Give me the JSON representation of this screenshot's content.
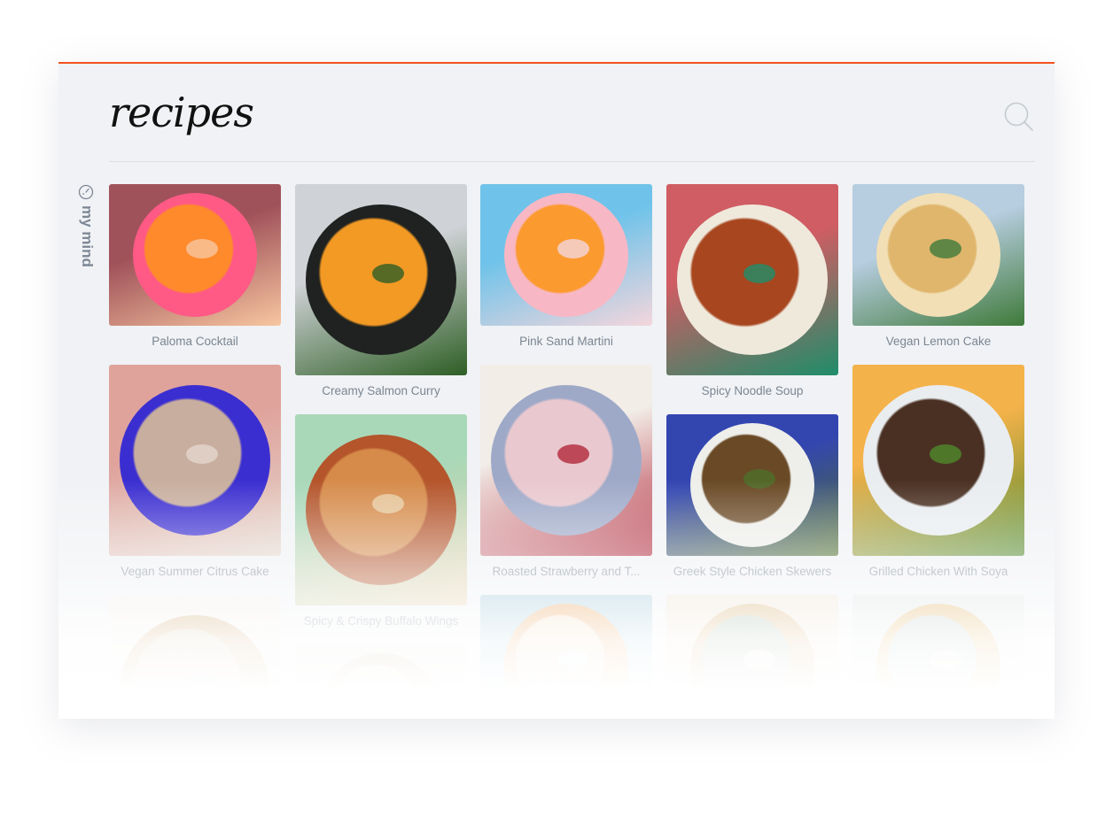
{
  "theme": {
    "accent": "#f4511e",
    "background": "#f0f2f5",
    "caption_color": "#7b8591"
  },
  "header": {
    "title": "recipes",
    "search_icon": "search-icon"
  },
  "sidebar": {
    "label": "my mind",
    "icon": "gauge-icon"
  },
  "recipes": [
    {
      "title": "Paloma Cocktail",
      "image": "cocktail-photo",
      "tall": false,
      "colors": [
        "#a0525a",
        "#ff5a86",
        "#ff8a2b",
        "#f7c6a0"
      ]
    },
    {
      "title": "Creamy Salmon Curry",
      "image": "salmon-curry-photo",
      "tall": true,
      "colors": [
        "#cfd2d6",
        "#1f2220",
        "#f39a24",
        "#2e5e25"
      ]
    },
    {
      "title": "Pink Sand Martini",
      "image": "martini-photo",
      "tall": false,
      "colors": [
        "#6fc3ea",
        "#f8b7c4",
        "#fb9a2e",
        "#f4d6dc"
      ]
    },
    {
      "title": "Spicy Noodle Soup",
      "image": "noodle-soup-photo",
      "tall": true,
      "colors": [
        "#cf5d63",
        "#efe9dc",
        "#a8461f",
        "#1f8d6a"
      ]
    },
    {
      "title": "Vegan Lemon Cake",
      "image": "lemon-cake-photo",
      "tall": false,
      "colors": [
        "#b7cde0",
        "#f2dfb6",
        "#e0b66d",
        "#3f7a3a"
      ]
    },
    {
      "title": "Vegan Summer Citrus Cake",
      "image": "citrus-cake-photo",
      "tall": true,
      "colors": [
        "#dfa39c",
        "#3b2ed1",
        "#c8ae9e",
        "#e4d6cc"
      ]
    },
    {
      "title": "Spicy & Crispy Buffalo Wings",
      "image": "buffalo-wings-photo",
      "tall": true,
      "colors": [
        "#a9d8b8",
        "#b4552b",
        "#d68b4a",
        "#e8d0a8"
      ]
    },
    {
      "title": "Roasted Strawberry and T...",
      "image": "strawberry-smoothie-photo",
      "tall": true,
      "colors": [
        "#f2ede7",
        "#9ea9c8",
        "#e9c8cf",
        "#b1283a"
      ]
    },
    {
      "title": "Greek Style Chicken Skewers",
      "image": "chicken-skewers-photo",
      "tall": false,
      "colors": [
        "#3346b0",
        "#eeeeea",
        "#6a4a26",
        "#4e6e2a"
      ]
    },
    {
      "title": "Grilled Chicken With Soya",
      "image": "grilled-chicken-photo",
      "tall": true,
      "colors": [
        "#f4b24a",
        "#e9edf0",
        "#4a3022",
        "#4f8a2c"
      ]
    },
    {
      "title": "",
      "image": "bowl-photo",
      "tall": true,
      "colors": [
        "#f3efe9",
        "#c89a5a",
        "#d7c7a9",
        "#7aa39a"
      ]
    },
    {
      "title": "",
      "image": "dessert-photo",
      "tall": false,
      "colors": [
        "#e9e4dc",
        "#caa676",
        "#f0e0c8",
        "#bdbdbd"
      ]
    },
    {
      "title": "",
      "image": "drink-photo",
      "tall": false,
      "colors": [
        "#9fc9d8",
        "#e89a4a",
        "#f1d9b8",
        "#dfeef2"
      ]
    },
    {
      "title": "",
      "image": "pastry-photo",
      "tall": false,
      "colors": [
        "#efe3d2",
        "#d5a865",
        "#9db4a0",
        "#f4efe8"
      ]
    },
    {
      "title": "",
      "image": "soup-photo",
      "tall": false,
      "colors": [
        "#dfe5e3",
        "#e0ac55",
        "#b9c8c4",
        "#f1eeea"
      ]
    }
  ]
}
